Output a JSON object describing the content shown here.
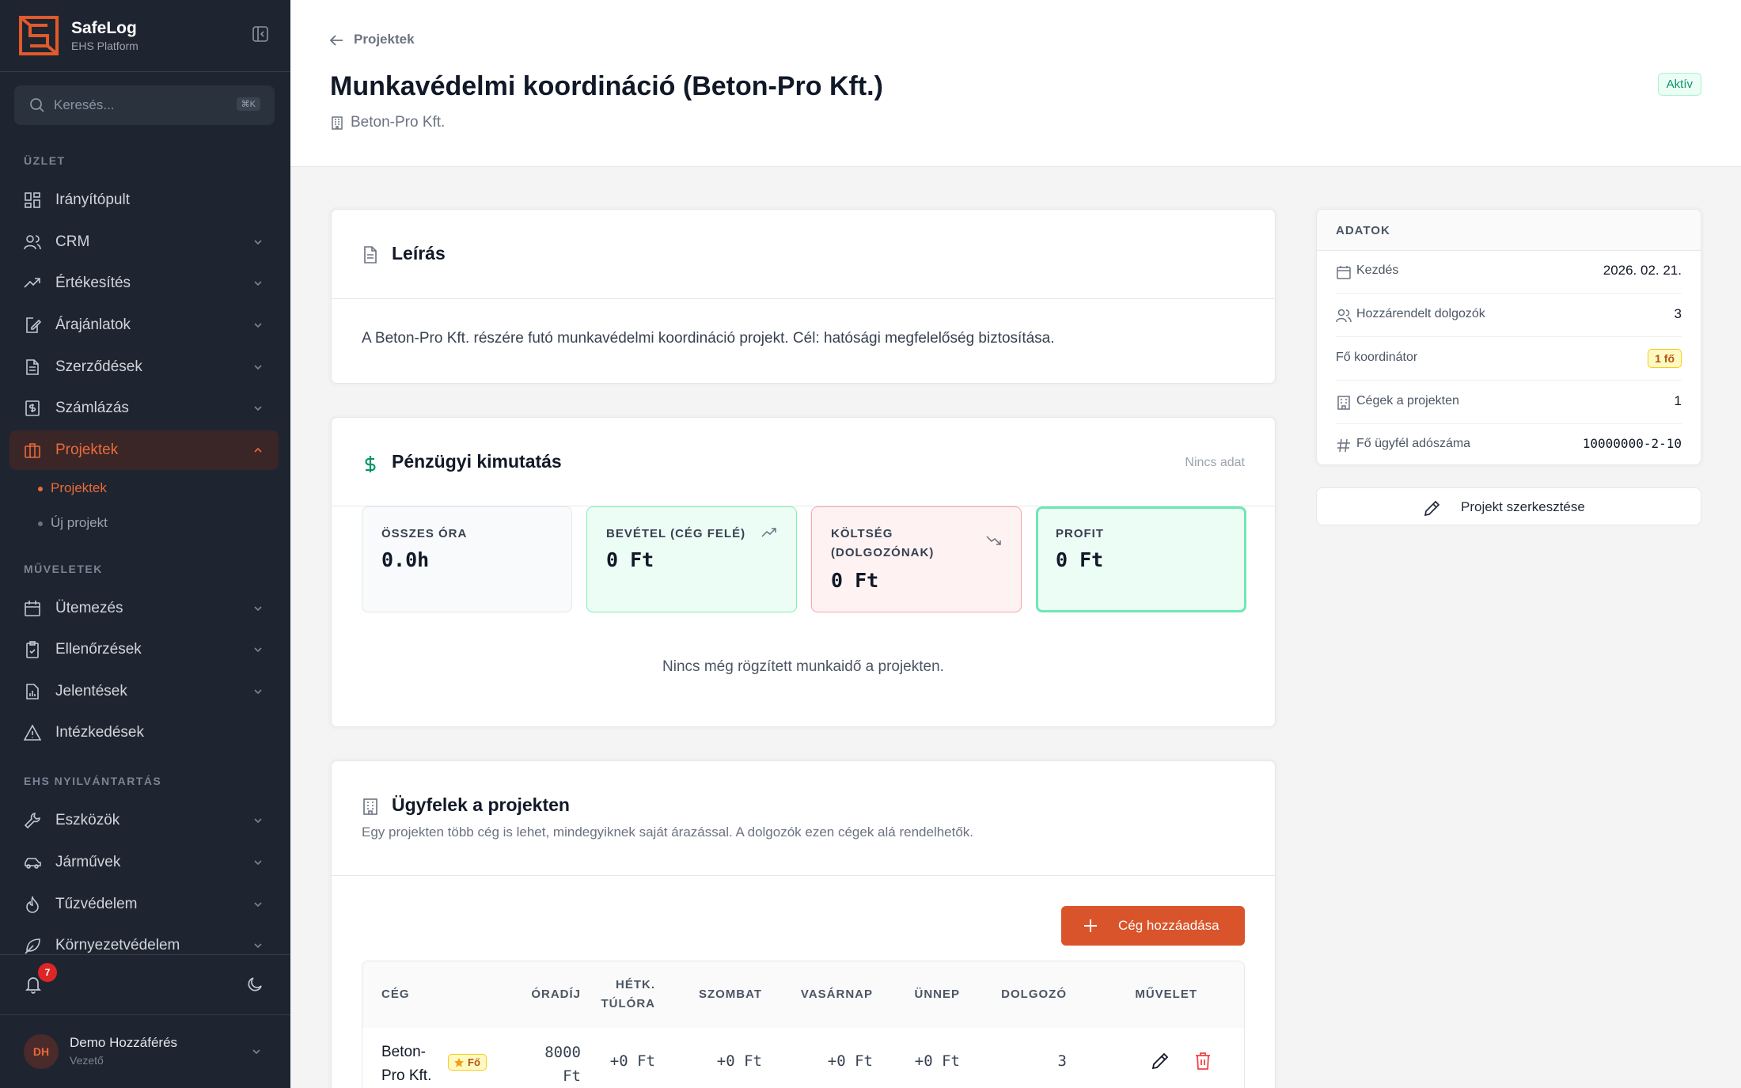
{
  "brand": {
    "name": "SafeLog",
    "subtitle": "EHS Platform"
  },
  "search": {
    "placeholder": "Keresés...",
    "shortcut": "⌘K"
  },
  "sidebar": {
    "sections": [
      {
        "title": "ÜZLET"
      },
      {
        "title": "MŰVELETEK"
      },
      {
        "title": "EHS NYILVÁNTARTÁS"
      }
    ],
    "items": [
      {
        "label": "Irányítópult",
        "icon": "dashboard-icon"
      },
      {
        "label": "CRM",
        "icon": "users-icon"
      },
      {
        "label": "Értékesítés",
        "icon": "trend-icon"
      },
      {
        "label": "Árajánlatok",
        "icon": "file-edit-icon"
      },
      {
        "label": "Szerződések",
        "icon": "file-icon"
      },
      {
        "label": "Számlázás",
        "icon": "invoice-icon"
      },
      {
        "label": "Projektek",
        "icon": "briefcase-icon"
      },
      {
        "label": "Ütemezés",
        "icon": "calendar-icon"
      },
      {
        "label": "Ellenőrzések",
        "icon": "clipboard-icon"
      },
      {
        "label": "Jelentések",
        "icon": "report-icon"
      },
      {
        "label": "Intézkedések",
        "icon": "warning-icon"
      },
      {
        "label": "Eszközök",
        "icon": "wrench-icon"
      },
      {
        "label": "Járművek",
        "icon": "car-icon"
      },
      {
        "label": "Tűzvédelem",
        "icon": "flame-icon"
      },
      {
        "label": "Környezetvédelem",
        "icon": "leaf-icon"
      }
    ],
    "subitems": [
      {
        "label": "Projektek"
      },
      {
        "label": "Új projekt"
      }
    ]
  },
  "notifications": {
    "count": "7"
  },
  "user": {
    "initials": "DH",
    "name": "Demo Hozzáférés",
    "role": "Vezető"
  },
  "header": {
    "back_label": "Projektek",
    "title": "Munkavédelmi koordináció (Beton-Pro Kft.)",
    "company": "Beton-Pro Kft.",
    "status": "Aktív"
  },
  "description": {
    "title": "Leírás",
    "text": "A Beton-Pro Kft. részére futó munkavédelmi koordináció projekt. Cél: hatósági megfelelőség biztosítása."
  },
  "finance": {
    "title": "Pénzügyi kimutatás",
    "no_data": "Nincs adat",
    "stats": [
      {
        "label": "ÖSSZES ÓRA",
        "value": "0.0h"
      },
      {
        "label": "BEVÉTEL (CÉG FELÉ)",
        "value": "0 Ft"
      },
      {
        "label": "KÖLTSÉG (DOLGOZÓNAK)",
        "value": "0 Ft"
      },
      {
        "label": "PROFIT",
        "value": "0 Ft"
      }
    ],
    "empty": "Nincs még rögzített munkaidő a projekten."
  },
  "clients": {
    "title": "Ügyfelek a projekten",
    "subtitle": "Egy projekten több cég is lehet, mindegyiknek saját árazással. A dolgozók ezen cégek alá rendelhetők.",
    "add_label": "Cég hozzáadása",
    "columns": [
      "CÉG",
      "ÓRADÍJ",
      "HÉTK. TÚLÓRA",
      "SZOMBAT",
      "VASÁRNAP",
      "ÜNNEP",
      "DOLGOZÓ",
      "MŰVELET"
    ],
    "rows": [
      {
        "company": "Beton-Pro Kft.",
        "badge": "Fő",
        "rate": "8000 Ft",
        "overtime": "+0 Ft",
        "saturday": "+0 Ft",
        "sunday": "+0 Ft",
        "holiday": "+0 Ft",
        "workers": "3"
      }
    ]
  },
  "details": {
    "title": "ADATOK",
    "rows": [
      {
        "key": "Kezdés",
        "value": "2026. 02. 21."
      },
      {
        "key": "Hozzárendelt dolgozók",
        "value": "3"
      },
      {
        "key": "Fő koordinátor",
        "value": "1 fő"
      },
      {
        "key": "Cégek a projekten",
        "value": "1"
      },
      {
        "key": "Fő ügyfél adószáma",
        "value": "10000000-2-10"
      }
    ],
    "edit_label": "Projekt szerkesztése"
  },
  "colors": {
    "accent": "#d9542a",
    "sidebar": "#1e2530",
    "success": "#059669"
  }
}
